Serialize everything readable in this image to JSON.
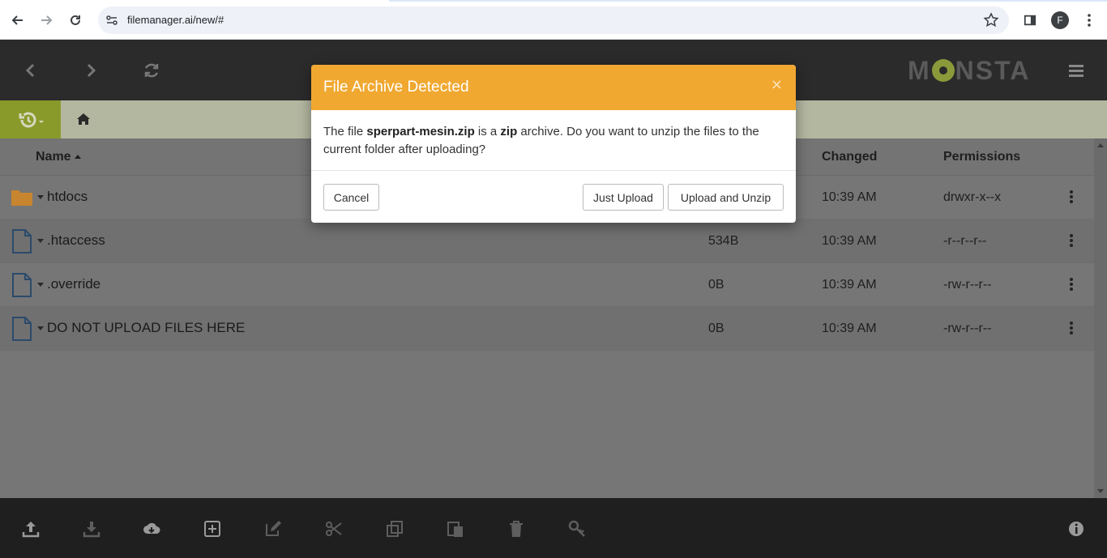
{
  "browser": {
    "url": "filemanager.ai/new/#",
    "profile_initial": "F"
  },
  "app": {
    "logo_text_left": "M",
    "logo_text_right": "NSTA"
  },
  "table": {
    "headers": {
      "name": "Name",
      "changed": "Changed",
      "permissions": "Permissions"
    },
    "rows": [
      {
        "name": "htdocs",
        "type": "folder",
        "size": "",
        "changed": "10:39 AM",
        "permissions": "drwxr-x--x"
      },
      {
        "name": ".htaccess",
        "type": "file",
        "size": "534B",
        "changed": "10:39 AM",
        "permissions": "-r--r--r--"
      },
      {
        "name": ".override",
        "type": "file",
        "size": "0B",
        "changed": "10:39 AM",
        "permissions": "-rw-r--r--"
      },
      {
        "name": "DO NOT UPLOAD FILES HERE",
        "type": "file",
        "size": "0B",
        "changed": "10:39 AM",
        "permissions": "-rw-r--r--"
      }
    ]
  },
  "modal": {
    "title": "File Archive Detected",
    "close": "×",
    "body_pre": "The file ",
    "filename": "sperpart-mesin.zip",
    "body_mid": " is a ",
    "archive_type": "zip",
    "body_post": " archive. Do you want to unzip the files to the current folder after uploading?",
    "cancel_label": "Cancel",
    "just_upload_label": "Just Upload",
    "upload_unzip_label": "Upload and Unzip"
  },
  "colors": {
    "modal_header": "#f0a830",
    "header_bg": "#2b2b2b",
    "accent_green": "#8a9a2a"
  }
}
